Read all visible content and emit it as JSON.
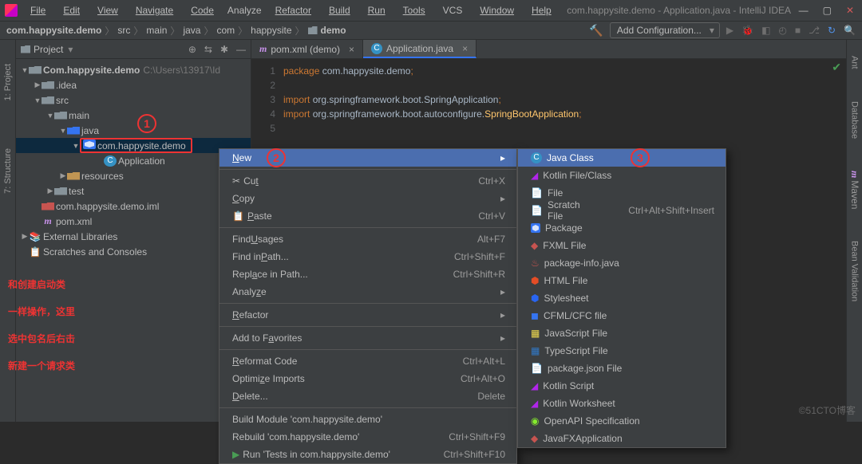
{
  "menubar": [
    "File",
    "Edit",
    "View",
    "Navigate",
    "Code",
    "Analyze",
    "Refactor",
    "Build",
    "Run",
    "Tools",
    "VCS",
    "Window",
    "Help"
  ],
  "titlebar": {
    "title": "com.happysite.demo - Application.java - IntelliJ IDEA"
  },
  "win": {
    "min": "—",
    "max": "▢",
    "close": "✕"
  },
  "breadcrumbs": [
    "com.happysite.demo",
    "src",
    "main",
    "java",
    "com",
    "happysite",
    "demo"
  ],
  "toolbar": {
    "add_config": "Add Configuration..."
  },
  "left_gutter": [
    "1: Project",
    "7: Structure"
  ],
  "project": {
    "title": "Project",
    "tree": {
      "root": "Com.happysite.demo",
      "root_path": "C:\\Users\\13917\\Id",
      "idea": ".idea",
      "src": "src",
      "main": "main",
      "java": "java",
      "pkg": "com.happysite.demo",
      "app": "Application",
      "resources": "resources",
      "test": "test",
      "iml": "com.happysite.demo.iml",
      "pom": "pom.xml",
      "ext": "External Libraries",
      "scratch": "Scratches and Consoles"
    }
  },
  "tabs": [
    {
      "label": "pom.xml (demo)",
      "icon": "m",
      "active": false
    },
    {
      "label": "Application.java",
      "icon": "c",
      "active": true
    }
  ],
  "code": {
    "line_numbers": [
      "1",
      "2",
      "3",
      "4",
      "5"
    ],
    "l1_kw": "package ",
    "l1_rest": "com.happysite.demo",
    "l1_semi": ";",
    "l3_kw": "import ",
    "l3_rest": "org.springframework.boot.SpringApplication",
    "l3_semi": ";",
    "l4_kw": "import ",
    "l4_rest": "org.springframework.boot.autoconfigure.",
    "l4_cls": "SpringBootApplication",
    "l4_semi": ";"
  },
  "ctx_main": [
    {
      "t": "hl",
      "label": "New",
      "arr": "▸"
    },
    {
      "t": "sep"
    },
    {
      "label": "Cut",
      "u": "X",
      "rest": " Cut",
      "sc": "Ctrl+X",
      "pre": ""
    },
    {
      "label": "Copy",
      "u": "C",
      "rest": "opy",
      "arr": "▸"
    },
    {
      "label": "Paste",
      "u": "P",
      "rest": "aste",
      "sc": "Ctrl+V"
    },
    {
      "t": "sep"
    },
    {
      "label": "Find Usages",
      "u": "U",
      "sc": "Alt+F7"
    },
    {
      "label": "Find in Path...",
      "sc": "Ctrl+Shift+F"
    },
    {
      "label": "Replace in Path...",
      "sc": "Ctrl+Shift+R"
    },
    {
      "label": "Analyze",
      "u": "z",
      "arr": "▸"
    },
    {
      "t": "sep"
    },
    {
      "label": "Refactor",
      "u": "R",
      "arr": "▸"
    },
    {
      "t": "sep"
    },
    {
      "label": "Add to Favorites",
      "u": "v",
      "arr": "▸"
    },
    {
      "t": "sep"
    },
    {
      "label": "Reformat Code",
      "u": "R",
      "sc": "Ctrl+Alt+L"
    },
    {
      "label": "Optimize Imports",
      "u": "z",
      "sc": "Ctrl+Alt+O"
    },
    {
      "label": "Delete...",
      "u": "D",
      "sc": "Delete"
    },
    {
      "t": "sep"
    },
    {
      "label": "Build Module 'com.happysite.demo'"
    },
    {
      "label": "Rebuild 'com.happysite.demo'",
      "sc": "Ctrl+Shift+F9"
    },
    {
      "label": "Run 'Tests in com.happysite.demo'",
      "sc": "Ctrl+Shift+F10",
      "icon": "run"
    }
  ],
  "ctx_new": [
    {
      "t": "hl",
      "label": "Java Class",
      "icon": "c"
    },
    {
      "label": "Kotlin File/Class",
      "icon": "k"
    },
    {
      "label": "File",
      "icon": "f"
    },
    {
      "label": "Scratch File",
      "icon": "f",
      "sc": "Ctrl+Alt+Shift+Insert"
    },
    {
      "label": "Package",
      "icon": "p"
    },
    {
      "label": "FXML File",
      "icon": "fx"
    },
    {
      "label": "package-info.java",
      "icon": "j"
    },
    {
      "label": "HTML File",
      "icon": "h"
    },
    {
      "label": "Stylesheet",
      "icon": "css"
    },
    {
      "label": "CFML/CFC file",
      "icon": "cf"
    },
    {
      "label": "JavaScript File",
      "icon": "js"
    },
    {
      "label": "TypeScript File",
      "icon": "ts"
    },
    {
      "label": "package.json File",
      "icon": "f"
    },
    {
      "label": "Kotlin Script",
      "icon": "k"
    },
    {
      "label": "Kotlin Worksheet",
      "icon": "k"
    },
    {
      "label": "OpenAPI Specification",
      "icon": "o"
    },
    {
      "label": "JavaFXApplication",
      "icon": "fx"
    }
  ],
  "right_gutter": [
    "Ant",
    "Database",
    "Maven",
    "Bean Validation"
  ],
  "annotation": {
    "n1": "1",
    "n2": "2",
    "n3": "3",
    "line1": "和创建启动类",
    "line2": "一样操作，这里",
    "line3": "选中包名后右击",
    "line4": "新建一个请求类"
  },
  "watermark": "©51CTO博客"
}
